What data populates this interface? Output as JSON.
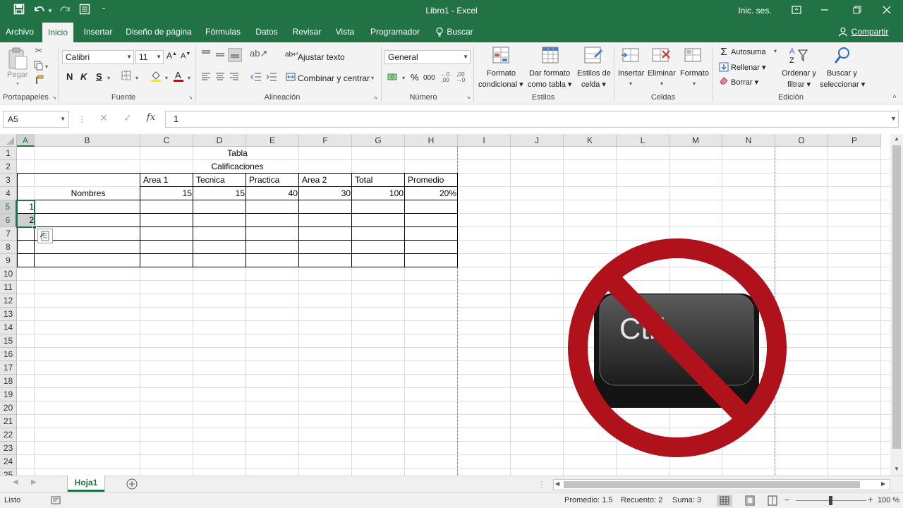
{
  "window": {
    "title": "Libro1  -  Excel",
    "signin": "Inic. ses."
  },
  "qat": {
    "save_icon": "save-icon",
    "undo_icon": "undo-icon",
    "redo_icon": "redo-icon"
  },
  "tabs": [
    {
      "label": "Archivo"
    },
    {
      "label": "Inicio"
    },
    {
      "label": "Insertar"
    },
    {
      "label": "Diseño de página"
    },
    {
      "label": "Fórmulas"
    },
    {
      "label": "Datos"
    },
    {
      "label": "Revisar"
    },
    {
      "label": "Vista"
    },
    {
      "label": "Programador"
    },
    {
      "label": "Buscar"
    }
  ],
  "share": "Compartir",
  "ribbon": {
    "clipboard": {
      "paste": "Pegar",
      "group": "Portapapeles"
    },
    "font": {
      "name": "Calibri",
      "size": "11",
      "bold": "N",
      "italic": "K",
      "underline": "S",
      "group": "Fuente"
    },
    "alignment": {
      "wrap": "Ajustar texto",
      "merge": "Combinar y centrar",
      "group": "Alineación"
    },
    "number": {
      "format": "General",
      "percent": "%",
      "thousands": "000",
      "group": "Número"
    },
    "styles": {
      "conditional": [
        "Formato",
        "condicional"
      ],
      "as_table": [
        "Dar formato",
        "como tabla"
      ],
      "cell_styles": [
        "Estilos de",
        "celda"
      ],
      "group": "Estilos"
    },
    "cells": {
      "insert": "Insertar",
      "delete": "Eliminar",
      "format": "Formato",
      "group": "Celdas"
    },
    "editing": {
      "autosum": "Autosuma",
      "fill": "Rellenar",
      "clear": "Borrar",
      "sort": [
        "Ordenar y",
        "filtrar"
      ],
      "find": [
        "Buscar y",
        "seleccionar"
      ],
      "group": "Edición"
    }
  },
  "formula_bar": {
    "name_box": "A5",
    "fx": "fx",
    "value": "1"
  },
  "columns": [
    "A",
    "B",
    "C",
    "D",
    "E",
    "F",
    "G",
    "H",
    "I",
    "J",
    "K",
    "L",
    "M",
    "N",
    "O",
    "P"
  ],
  "rows": [
    "1",
    "2",
    "3",
    "4",
    "5",
    "6",
    "7",
    "8",
    "9",
    "10",
    "11",
    "12",
    "13",
    "14",
    "15",
    "16",
    "17",
    "18",
    "19",
    "20",
    "21",
    "22",
    "23",
    "24",
    "25"
  ],
  "sheet": {
    "title": "Tabla",
    "subtitle": "Calificaciones",
    "headers": [
      "Area 1",
      "Tecnica",
      "Practica",
      "Area 2",
      "Total",
      "Promedio"
    ],
    "names_label": "Nombres",
    "weights": [
      "15",
      "15",
      "40",
      "30",
      "100",
      "20%"
    ],
    "seq": [
      "1",
      "2"
    ]
  },
  "sheet_tab": "Hoja1",
  "status": {
    "ready": "Listo",
    "average": "Promedio: 1.5",
    "count": "Recuento: 2",
    "sum": "Suma: 3",
    "zoom": "100 %"
  },
  "overlay": {
    "key_text": "Ctrl",
    "sign_color": "#b0121c"
  },
  "colors": {
    "accent": "#217346"
  }
}
